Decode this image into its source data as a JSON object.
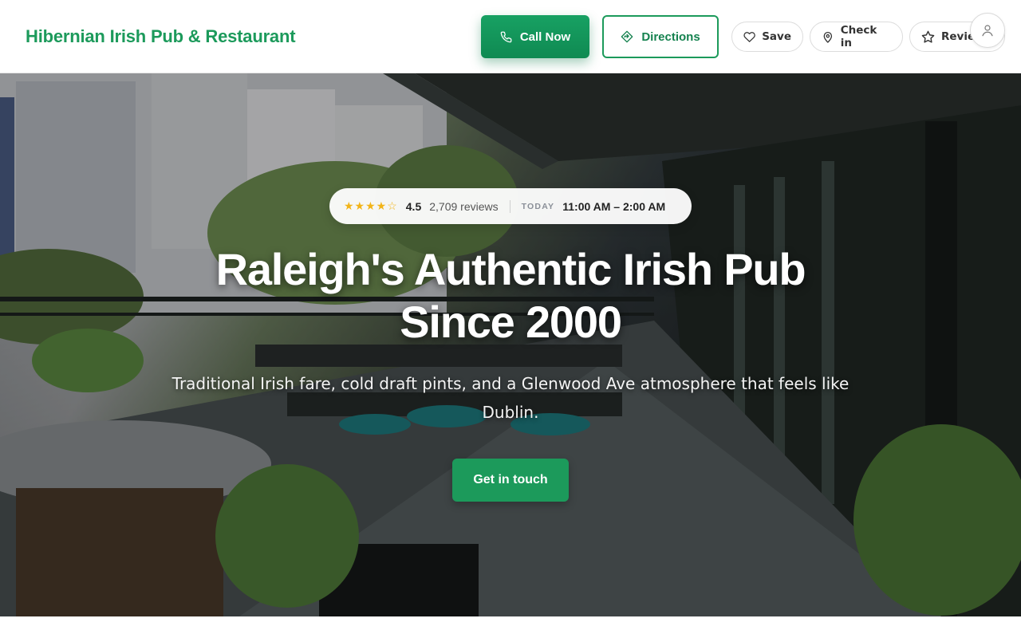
{
  "header": {
    "brand": "Hibernian Irish Pub & Restaurant",
    "call_label": "Call Now",
    "directions_label": "Directions",
    "save_label": "Save",
    "checkin_label": "Check in",
    "review_label": "Review"
  },
  "hero": {
    "rating": "4.5",
    "reviews": "2,709 reviews",
    "today_label": "TODAY",
    "hours": "11:00 AM – 2:00 AM",
    "title": "Raleigh's Authentic Irish Pub Since 2000",
    "subtitle": "Traditional Irish fare, cold draft pints, and a Glenwood Ave atmosphere that feels like Dublin.",
    "cta_label": "Get in touch"
  },
  "colors": {
    "brand_green": "#1c9a5b",
    "star_gold": "#f2b418"
  },
  "icons": {
    "call": "phone-icon",
    "directions": "directions-icon",
    "save": "heart-icon",
    "checkin": "map-pin-icon",
    "review": "star-icon",
    "account": "user-icon"
  },
  "rating_value": 4.5
}
